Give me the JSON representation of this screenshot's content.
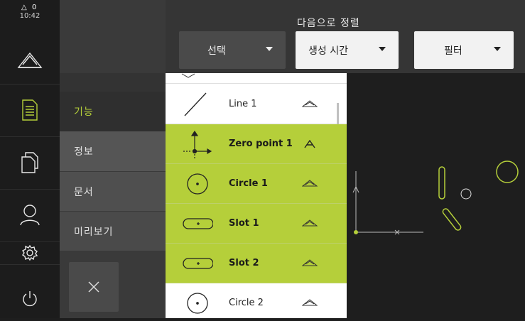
{
  "status": {
    "warning_count": "0",
    "time": "10:42"
  },
  "rail": {
    "items": [
      {
        "icon": "measure-triangle-icon"
      },
      {
        "icon": "document-list-icon"
      },
      {
        "icon": "copy-files-icon"
      },
      {
        "icon": "user-icon"
      },
      {
        "icon": "gear-icon"
      },
      {
        "icon": "power-icon"
      }
    ]
  },
  "menu": {
    "items": [
      {
        "label": "기능",
        "active": true
      },
      {
        "label": "정보"
      },
      {
        "label": "문서"
      },
      {
        "label": "미리보기"
      }
    ],
    "close_icon": "close-icon"
  },
  "toolbar": {
    "sort_label": "다음으로 정렬",
    "select_label": "선택",
    "sort_value": "생성 시간",
    "filter_label": "필터"
  },
  "features": [
    {
      "name": "Line 1",
      "icon": "line-icon",
      "highlight": false
    },
    {
      "name": "Zero point 1",
      "icon": "zero-point-icon",
      "highlight": true
    },
    {
      "name": "Circle 1",
      "icon": "circle-icon",
      "highlight": true
    },
    {
      "name": "Slot 1",
      "icon": "slot-icon",
      "highlight": true
    },
    {
      "name": "Slot 2",
      "icon": "slot-icon",
      "highlight": true
    },
    {
      "name": "Circle 2",
      "icon": "circle-icon",
      "highlight": false
    }
  ],
  "colors": {
    "accent": "#b5cf3a",
    "background": "#1e1e1e",
    "menu": "#3a3a3a"
  }
}
